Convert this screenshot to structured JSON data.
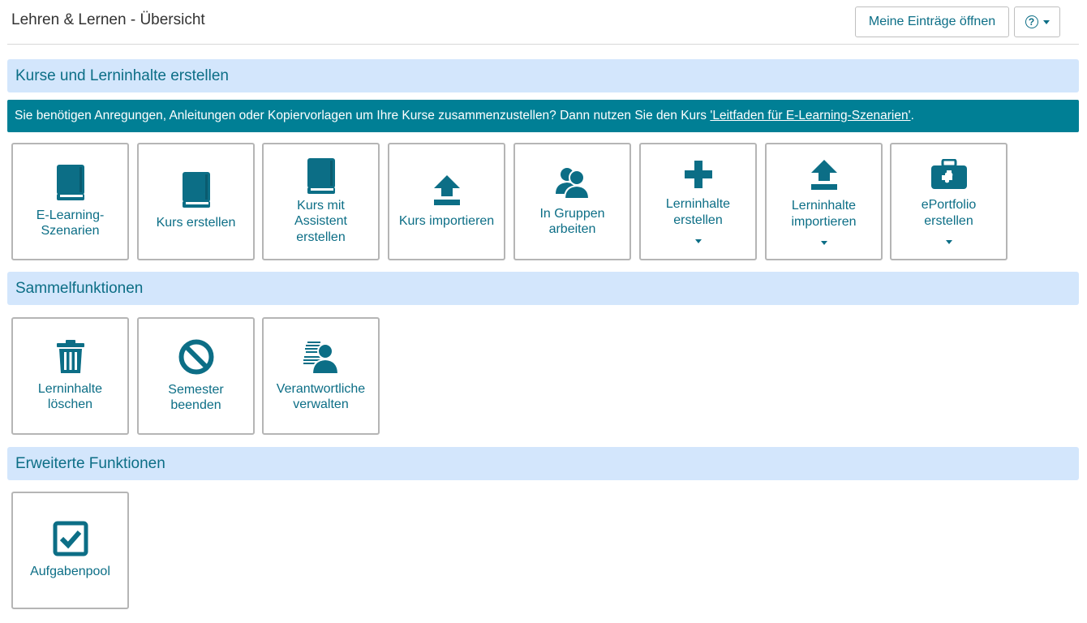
{
  "header": {
    "title": "Lehren & Lernen - Übersicht",
    "my_entries_label": "Meine Einträge öffnen",
    "help_symbol": "?"
  },
  "sections": {
    "create": {
      "title": "Kurse und Lerninhalte erstellen",
      "info_text": "Sie benötigen Anregungen, Anleitungen oder Kopiervorlagen um Ihre Kurse zusammenzustellen? Dann nutzen Sie den Kurs ",
      "info_link": "'Leitfaden für E-Learning-Szenarien'",
      "info_suffix": ".",
      "tiles": [
        {
          "label": "E-Learning-Szenarien",
          "icon": "book-icon"
        },
        {
          "label": "Kurs erstellen",
          "icon": "book-icon"
        },
        {
          "label": "Kurs mit Assistent erstellen",
          "icon": "book-icon"
        },
        {
          "label": "Kurs importieren",
          "icon": "upload-icon"
        },
        {
          "label": "In Gruppen arbeiten",
          "icon": "users-icon"
        },
        {
          "label": "Lerninhalte erstellen",
          "icon": "plus-icon",
          "dropdown": true
        },
        {
          "label": "Lerninhalte importieren",
          "icon": "upload-icon",
          "dropdown": true
        },
        {
          "label": "ePortfolio erstellen",
          "icon": "portfolio-icon",
          "dropdown": true
        }
      ]
    },
    "collect": {
      "title": "Sammelfunktionen",
      "tiles": [
        {
          "label": "Lerninhalte löschen",
          "icon": "trash-icon"
        },
        {
          "label": "Semester beenden",
          "icon": "ban-icon"
        },
        {
          "label": "Verantwortliche verwalten",
          "icon": "user-manage-icon"
        }
      ]
    },
    "extended": {
      "title": "Erweiterte Funktionen",
      "tiles": [
        {
          "label": "Aufgabenpool",
          "icon": "checkbox-icon"
        }
      ]
    }
  },
  "colors": {
    "accent": "#0c6e86",
    "info_bar": "#007f95",
    "section_bg": "#d3e6fc"
  }
}
